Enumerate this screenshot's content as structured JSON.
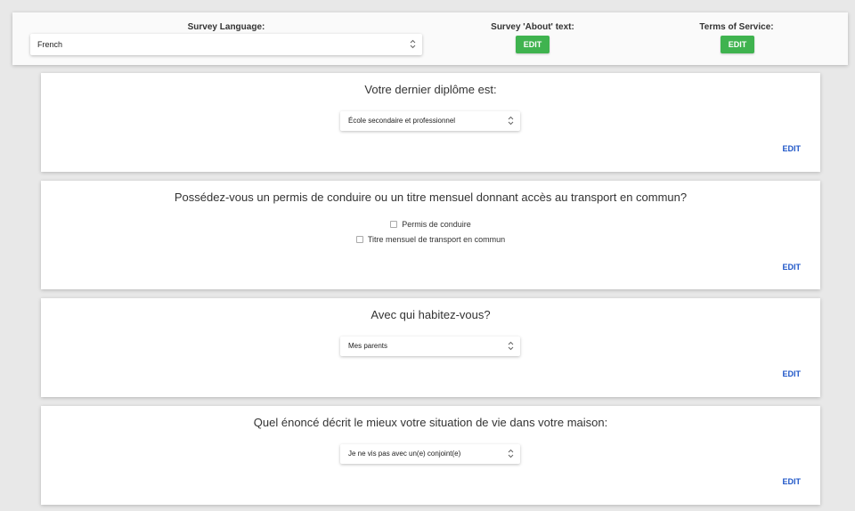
{
  "topbar": {
    "language_label": "Survey Language:",
    "language_value": "French",
    "about_label": "Survey 'About' text:",
    "about_button": "EDIT",
    "tos_label": "Terms of Service:",
    "tos_button": "EDIT"
  },
  "questions": [
    {
      "title": "Votre dernier diplôme est:",
      "type": "select",
      "selected": "École secondaire et professionnel",
      "edit_label": "EDIT"
    },
    {
      "title": "Possédez-vous un permis de conduire ou un titre mensuel donnant accès au transport en commun?",
      "type": "checkbox",
      "options": [
        "Permis de conduire",
        "Titre mensuel de transport en commun"
      ],
      "edit_label": "EDIT"
    },
    {
      "title": "Avec qui habitez-vous?",
      "type": "select",
      "selected": "Mes parents",
      "edit_label": "EDIT"
    },
    {
      "title": "Quel énoncé décrit le mieux votre situation de vie dans votre maison:",
      "type": "select",
      "selected": "Je ne vis pas avec un(e) conjoint(e)",
      "edit_label": "EDIT"
    }
  ],
  "colors": {
    "background": "#e8e8e8",
    "edit_button_green": "#3fb34f",
    "edit_link_blue": "#1e56c8"
  },
  "icons": [
    "select-caret-icon",
    "checkbox-icon"
  ]
}
